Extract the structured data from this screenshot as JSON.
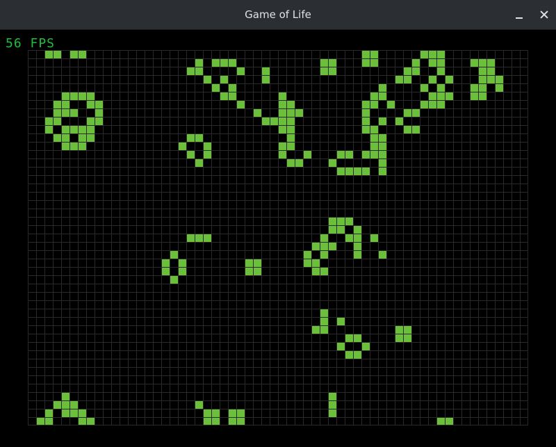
{
  "window": {
    "title": "Game of Life"
  },
  "status": {
    "fps_text": "56 FPS"
  },
  "colors": {
    "alive": "#6cbf3a",
    "grid_line": "#2a2a2a",
    "background": "#000000",
    "fps": "#1fbf3a"
  },
  "grid": {
    "cols": 60,
    "rows": 45,
    "live_cells": [
      [
        2,
        0
      ],
      [
        3,
        0
      ],
      [
        5,
        0
      ],
      [
        6,
        0
      ],
      [
        40,
        0
      ],
      [
        41,
        0
      ],
      [
        47,
        0
      ],
      [
        48,
        0
      ],
      [
        49,
        0
      ],
      [
        20,
        1
      ],
      [
        22,
        1
      ],
      [
        23,
        1
      ],
      [
        24,
        1
      ],
      [
        35,
        1
      ],
      [
        36,
        1
      ],
      [
        40,
        1
      ],
      [
        41,
        1
      ],
      [
        46,
        1
      ],
      [
        48,
        1
      ],
      [
        49,
        1
      ],
      [
        53,
        1
      ],
      [
        54,
        1
      ],
      [
        55,
        1
      ],
      [
        19,
        2
      ],
      [
        20,
        2
      ],
      [
        25,
        2
      ],
      [
        28,
        2
      ],
      [
        35,
        2
      ],
      [
        36,
        2
      ],
      [
        45,
        2
      ],
      [
        46,
        2
      ],
      [
        49,
        2
      ],
      [
        54,
        2
      ],
      [
        55,
        2
      ],
      [
        21,
        3
      ],
      [
        23,
        3
      ],
      [
        28,
        3
      ],
      [
        44,
        3
      ],
      [
        45,
        3
      ],
      [
        48,
        3
      ],
      [
        50,
        3
      ],
      [
        54,
        3
      ],
      [
        55,
        3
      ],
      [
        56,
        3
      ],
      [
        22,
        4
      ],
      [
        24,
        4
      ],
      [
        42,
        4
      ],
      [
        47,
        4
      ],
      [
        49,
        4
      ],
      [
        53,
        4
      ],
      [
        54,
        4
      ],
      [
        56,
        4
      ],
      [
        4,
        5
      ],
      [
        5,
        5
      ],
      [
        6,
        5
      ],
      [
        7,
        5
      ],
      [
        23,
        5
      ],
      [
        24,
        5
      ],
      [
        30,
        5
      ],
      [
        41,
        5
      ],
      [
        42,
        5
      ],
      [
        48,
        5
      ],
      [
        49,
        5
      ],
      [
        50,
        5
      ],
      [
        53,
        5
      ],
      [
        54,
        5
      ],
      [
        3,
        6
      ],
      [
        4,
        6
      ],
      [
        7,
        6
      ],
      [
        8,
        6
      ],
      [
        25,
        6
      ],
      [
        30,
        6
      ],
      [
        31,
        6
      ],
      [
        40,
        6
      ],
      [
        41,
        6
      ],
      [
        43,
        6
      ],
      [
        47,
        6
      ],
      [
        48,
        6
      ],
      [
        49,
        6
      ],
      [
        3,
        7
      ],
      [
        4,
        7
      ],
      [
        5,
        7
      ],
      [
        8,
        7
      ],
      [
        27,
        7
      ],
      [
        30,
        7
      ],
      [
        31,
        7
      ],
      [
        32,
        7
      ],
      [
        40,
        7
      ],
      [
        45,
        7
      ],
      [
        46,
        7
      ],
      [
        2,
        8
      ],
      [
        3,
        8
      ],
      [
        7,
        8
      ],
      [
        8,
        8
      ],
      [
        28,
        8
      ],
      [
        29,
        8
      ],
      [
        30,
        8
      ],
      [
        31,
        8
      ],
      [
        40,
        8
      ],
      [
        42,
        8
      ],
      [
        44,
        8
      ],
      [
        2,
        9
      ],
      [
        4,
        9
      ],
      [
        5,
        9
      ],
      [
        6,
        9
      ],
      [
        7,
        9
      ],
      [
        30,
        9
      ],
      [
        31,
        9
      ],
      [
        40,
        9
      ],
      [
        41,
        9
      ],
      [
        45,
        9
      ],
      [
        46,
        9
      ],
      [
        3,
        10
      ],
      [
        4,
        10
      ],
      [
        6,
        10
      ],
      [
        7,
        10
      ],
      [
        19,
        10
      ],
      [
        20,
        10
      ],
      [
        31,
        10
      ],
      [
        41,
        10
      ],
      [
        42,
        10
      ],
      [
        4,
        11
      ],
      [
        5,
        11
      ],
      [
        6,
        11
      ],
      [
        18,
        11
      ],
      [
        21,
        11
      ],
      [
        30,
        11
      ],
      [
        31,
        11
      ],
      [
        41,
        11
      ],
      [
        42,
        11
      ],
      [
        19,
        12
      ],
      [
        21,
        12
      ],
      [
        30,
        12
      ],
      [
        33,
        12
      ],
      [
        37,
        12
      ],
      [
        38,
        12
      ],
      [
        40,
        12
      ],
      [
        41,
        12
      ],
      [
        42,
        12
      ],
      [
        20,
        13
      ],
      [
        31,
        13
      ],
      [
        32,
        13
      ],
      [
        36,
        13
      ],
      [
        42,
        13
      ],
      [
        37,
        14
      ],
      [
        38,
        14
      ],
      [
        39,
        14
      ],
      [
        40,
        14
      ],
      [
        42,
        14
      ],
      [
        36,
        20
      ],
      [
        37,
        20
      ],
      [
        38,
        20
      ],
      [
        36,
        21
      ],
      [
        37,
        21
      ],
      [
        39,
        21
      ],
      [
        19,
        22
      ],
      [
        20,
        22
      ],
      [
        21,
        22
      ],
      [
        35,
        22
      ],
      [
        38,
        22
      ],
      [
        39,
        22
      ],
      [
        41,
        22
      ],
      [
        34,
        23
      ],
      [
        35,
        23
      ],
      [
        36,
        23
      ],
      [
        39,
        23
      ],
      [
        17,
        24
      ],
      [
        33,
        24
      ],
      [
        35,
        24
      ],
      [
        39,
        24
      ],
      [
        42,
        24
      ],
      [
        16,
        25
      ],
      [
        18,
        25
      ],
      [
        26,
        25
      ],
      [
        27,
        25
      ],
      [
        33,
        25
      ],
      [
        34,
        25
      ],
      [
        16,
        26
      ],
      [
        18,
        26
      ],
      [
        26,
        26
      ],
      [
        27,
        26
      ],
      [
        34,
        26
      ],
      [
        35,
        26
      ],
      [
        17,
        27
      ],
      [
        35,
        31
      ],
      [
        35,
        32
      ],
      [
        37,
        32
      ],
      [
        34,
        33
      ],
      [
        35,
        33
      ],
      [
        44,
        33
      ],
      [
        45,
        33
      ],
      [
        38,
        34
      ],
      [
        39,
        34
      ],
      [
        44,
        34
      ],
      [
        45,
        34
      ],
      [
        37,
        35
      ],
      [
        40,
        35
      ],
      [
        38,
        36
      ],
      [
        39,
        36
      ],
      [
        4,
        41
      ],
      [
        36,
        41
      ],
      [
        3,
        42
      ],
      [
        4,
        42
      ],
      [
        5,
        42
      ],
      [
        20,
        42
      ],
      [
        36,
        42
      ],
      [
        2,
        43
      ],
      [
        4,
        43
      ],
      [
        5,
        43
      ],
      [
        6,
        43
      ],
      [
        21,
        43
      ],
      [
        22,
        43
      ],
      [
        24,
        43
      ],
      [
        25,
        43
      ],
      [
        36,
        43
      ],
      [
        1,
        44
      ],
      [
        2,
        44
      ],
      [
        6,
        44
      ],
      [
        7,
        44
      ],
      [
        21,
        44
      ],
      [
        22,
        44
      ],
      [
        24,
        44
      ],
      [
        25,
        44
      ],
      [
        49,
        44
      ],
      [
        50,
        44
      ]
    ]
  }
}
